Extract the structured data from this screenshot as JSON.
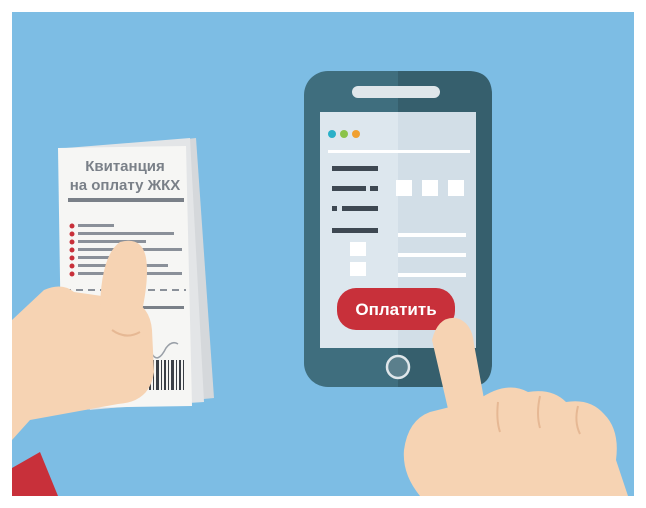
{
  "receipt": {
    "title_line1": "Квитанция",
    "title_line2": "на оплату ЖКХ"
  },
  "phone": {
    "pay_button_label": "Оплатить",
    "window_dots": [
      "#2ab0c8",
      "#8bc34a",
      "#f0a030"
    ]
  },
  "colors": {
    "background": "#7dbde4",
    "pay_button": "#c8303a",
    "phone_body": "#3f6e7e",
    "skin": "#f6d3b3"
  }
}
